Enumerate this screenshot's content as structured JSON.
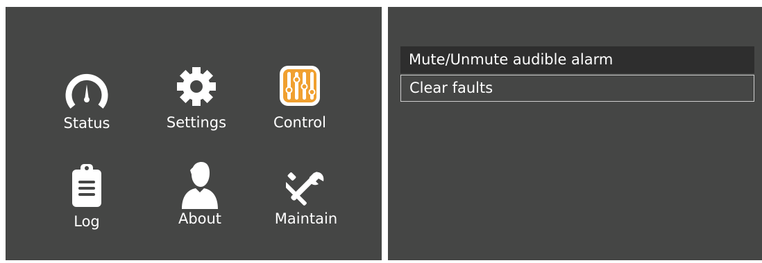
{
  "main_menu": {
    "items": [
      {
        "label": "Status",
        "icon": "gauge-icon"
      },
      {
        "label": "Settings",
        "icon": "gear-icon"
      },
      {
        "label": "Control",
        "icon": "sliders-icon"
      },
      {
        "label": "Log",
        "icon": "clipboard-icon"
      },
      {
        "label": "About",
        "icon": "person-icon"
      },
      {
        "label": "Maintain",
        "icon": "tools-icon"
      }
    ]
  },
  "control_menu": {
    "items": [
      {
        "label": "Mute/Unmute audible alarm",
        "state": "highlighted"
      },
      {
        "label": "Clear faults",
        "state": "selected"
      }
    ]
  },
  "colors": {
    "panel_bg": "#454645",
    "highlight_bg": "#2e2e2e",
    "accent": "#f0a030",
    "text": "#ffffff",
    "selection_border": "#cfcfcf"
  }
}
